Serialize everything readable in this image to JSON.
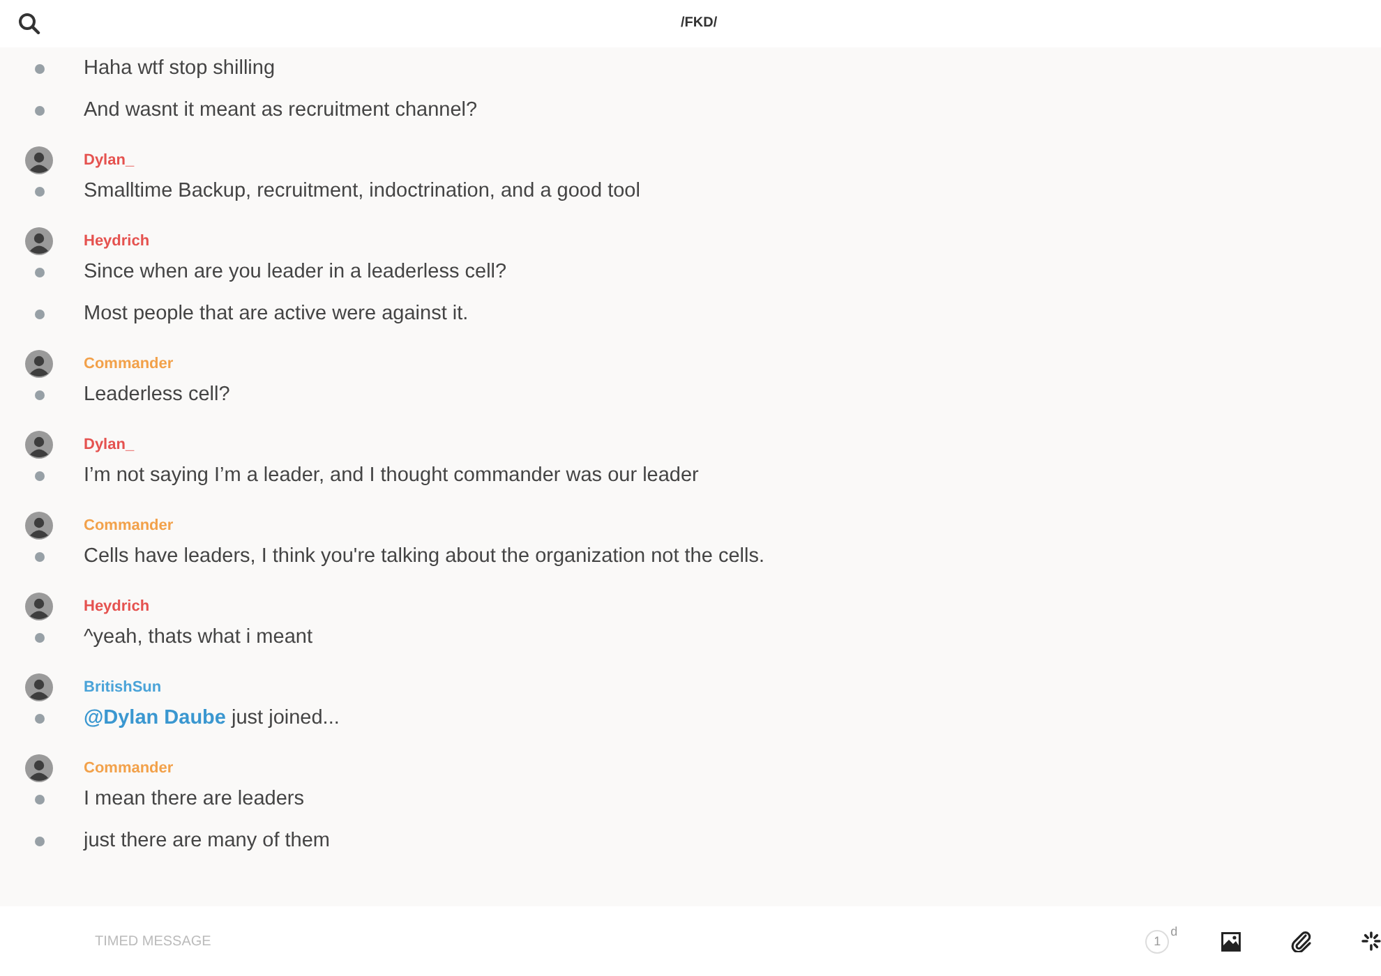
{
  "header": {
    "title": "/FKD/"
  },
  "groups": [
    {
      "messages": [
        {
          "text": "Haha wtf stop shilling"
        },
        {
          "text": "And wasnt it meant as recruitment channel?"
        }
      ]
    },
    {
      "author": "Dylan_",
      "color": "#e5524f",
      "messages": [
        {
          "text": "Smalltime Backup, recruitment, indoctrination, and a good tool"
        }
      ]
    },
    {
      "author": "Heydrich",
      "color": "#e5524f",
      "messages": [
        {
          "text": "Since when are you leader in a leaderless cell?"
        },
        {
          "text": "Most people that are active were against it."
        }
      ]
    },
    {
      "author": "Commander",
      "color": "#f2a14a",
      "messages": [
        {
          "text": "Leaderless cell?"
        }
      ]
    },
    {
      "author": "Dylan_",
      "color": "#e5524f",
      "messages": [
        {
          "text": "I’m not saying I’m a leader, and I thought commander was our leader"
        }
      ]
    },
    {
      "author": "Commander",
      "color": "#f2a14a",
      "messages": [
        {
          "text": "Cells have leaders, I think you're talking about the organization not the cells."
        }
      ]
    },
    {
      "author": "Heydrich",
      "color": "#e5524f",
      "messages": [
        {
          "text": "^yeah, thats what i meant"
        }
      ]
    },
    {
      "author": "BritishSun",
      "color": "#4aa3d8",
      "messages": [
        {
          "mention": "@Dylan Daube",
          "text": "just joined..."
        }
      ]
    },
    {
      "author": "Commander",
      "color": "#f2a14a",
      "messages": [
        {
          "text": "I mean there are leaders"
        },
        {
          "text": "just there are many of them"
        }
      ]
    }
  ],
  "composer": {
    "placeholder": "TIMED MESSAGE",
    "timer": "1",
    "timer_unit": "d"
  }
}
